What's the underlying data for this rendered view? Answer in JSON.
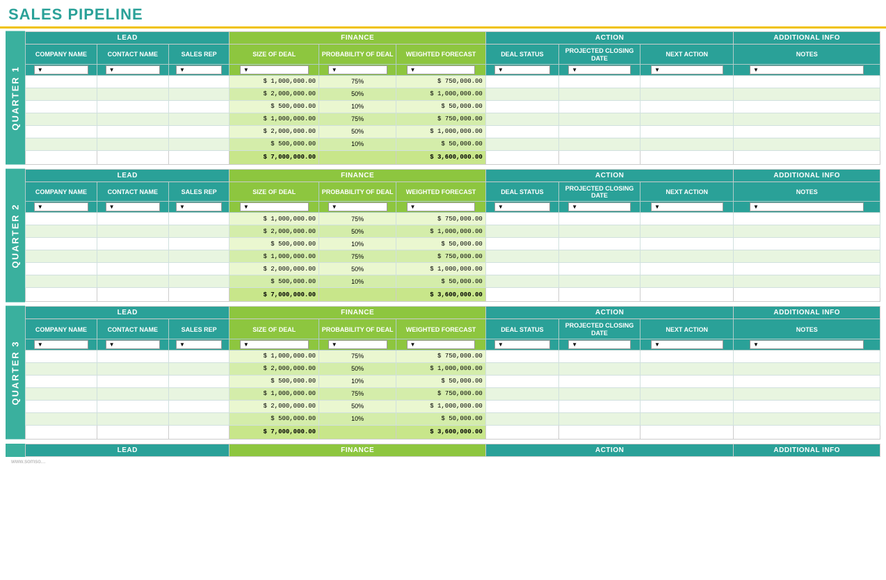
{
  "title": "SALES PIPELINE",
  "quarters": [
    {
      "label": "QUARTER 1",
      "id": "q1"
    },
    {
      "label": "QUARTER 2",
      "id": "q2"
    },
    {
      "label": "QUARTER 3",
      "id": "q3"
    }
  ],
  "section_headers": {
    "lead": "LEAD",
    "finance": "FINANCE",
    "action": "ACTION",
    "additional_info": "ADDITIONAL INFO"
  },
  "column_headers": {
    "company_name": "COMPANY NAME",
    "contact_name": "CONTACT NAME",
    "sales_rep": "SALES REP",
    "size_of_deal": "SIZE OF DEAL",
    "probability_of_deal": "PROBABILITY OF DEAL",
    "weighted_forecast": "WEIGHTED FORECAST",
    "deal_status": "DEAL STATUS",
    "projected_closing_date": "PROJECTED CLOSING DATE",
    "next_action": "NEXT ACTION",
    "notes": "NOTES"
  },
  "data_rows": [
    {
      "deal_size": "$ 1,000,000.00",
      "prob": "75%",
      "weighted": "$ 750,000.00",
      "style": "alt-white"
    },
    {
      "deal_size": "$ 2,000,000.00",
      "prob": "50%",
      "weighted": "$ 1,000,000.00",
      "style": "alt-green"
    },
    {
      "deal_size": "$ 500,000.00",
      "prob": "10%",
      "weighted": "$ 50,000.00",
      "style": "alt-white"
    },
    {
      "deal_size": "$ 1,000,000.00",
      "prob": "75%",
      "weighted": "$ 750,000.00",
      "style": "alt-green"
    },
    {
      "deal_size": "$ 2,000,000.00",
      "prob": "50%",
      "weighted": "$ 1,000,000.00",
      "style": "alt-white"
    },
    {
      "deal_size": "$ 500,000.00",
      "prob": "10%",
      "weighted": "$ 50,000.00",
      "style": "alt-green"
    }
  ],
  "totals": {
    "deal_size": "$ 7,000,000.00",
    "weighted": "$ 3,600,000.00"
  },
  "bottom_section": {
    "label": "",
    "headers": [
      "LEAD",
      "FINANCE",
      "ACTION",
      "ADDITIONAL INFO"
    ]
  }
}
